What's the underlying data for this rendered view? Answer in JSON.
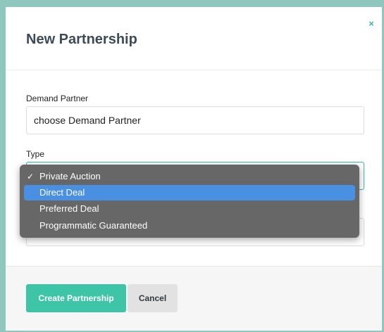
{
  "modal": {
    "title": "New Partnership",
    "close_label": "×"
  },
  "form": {
    "demand_partner": {
      "label": "Demand Partner",
      "value": "choose Demand Partner"
    },
    "type": {
      "label": "Type",
      "options": [
        {
          "label": "Private Auction",
          "checked": true,
          "highlighted": false
        },
        {
          "label": "Direct Deal",
          "checked": false,
          "highlighted": true
        },
        {
          "label": "Preferred Deal",
          "checked": false,
          "highlighted": false
        },
        {
          "label": "Programmatic Guaranteed",
          "checked": false,
          "highlighted": false
        }
      ],
      "check_mark": "✓"
    }
  },
  "footer": {
    "create_label": "Create Partnership",
    "cancel_label": "Cancel"
  },
  "colors": {
    "accent": "#3ec4a7",
    "dropdown_bg": "#676767",
    "highlight": "#4a90e2"
  }
}
